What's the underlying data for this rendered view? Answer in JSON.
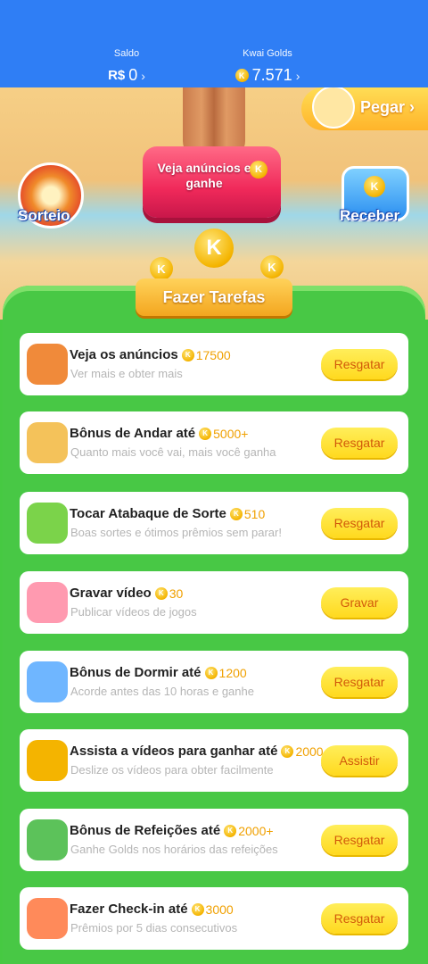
{
  "header": {
    "saldo_label": "Saldo",
    "saldo_currency": "R$",
    "saldo_value": "0",
    "golds_label": "Kwai Golds",
    "golds_value": "7.571",
    "chevron": "›"
  },
  "scene": {
    "pegar_label": "Pegar",
    "pegar_chevron": "›",
    "ads_button": "Veja anúncios e ganhe",
    "sorteio_label": "Sorteio",
    "receber_label": "Receber",
    "coin_letter": "K"
  },
  "tasks_banner": "Fazer Tarefas",
  "tasks": [
    {
      "title": "Veja os anúncios",
      "amount": "17500",
      "subtitle": "Ver mais e obter mais",
      "button": "Resgatar",
      "icon": "tv-icon"
    },
    {
      "title": "Bônus de Andar até",
      "amount": "5000+",
      "subtitle": "Quanto mais você vai, mais você ganha",
      "button": "Resgatar",
      "icon": "walking-boy-icon"
    },
    {
      "title": "Tocar Atabaque de Sorte",
      "amount": "510",
      "subtitle": "Boas sortes e ótimos prêmios sem parar!",
      "button": "Resgatar",
      "icon": "drum-icon"
    },
    {
      "title": "Gravar vídeo",
      "amount": "30",
      "subtitle": "Publicar vídeos de jogos",
      "button": "Gravar",
      "icon": "camera-icon"
    },
    {
      "title": "Bônus de Dormir até",
      "amount": "1200",
      "subtitle": "Acorde antes das 10 horas e ganhe",
      "button": "Resgatar",
      "icon": "moon-icon"
    },
    {
      "title": "Assista a vídeos para ganhar até",
      "amount": "2000",
      "subtitle": "Deslize os vídeos para obter facilmente",
      "button": "Assistir",
      "icon": "video-camera-icon"
    },
    {
      "title": "Bônus de Refeições até",
      "amount": "2000+",
      "subtitle": "Ganhe Golds nos horários das refeições",
      "button": "Resgatar",
      "icon": "meal-icon"
    },
    {
      "title": "Fazer Check-in até",
      "amount": "3000",
      "subtitle": "Prêmios por 5 dias consecutivos",
      "button": "Resgatar",
      "icon": "calendar-icon"
    }
  ]
}
